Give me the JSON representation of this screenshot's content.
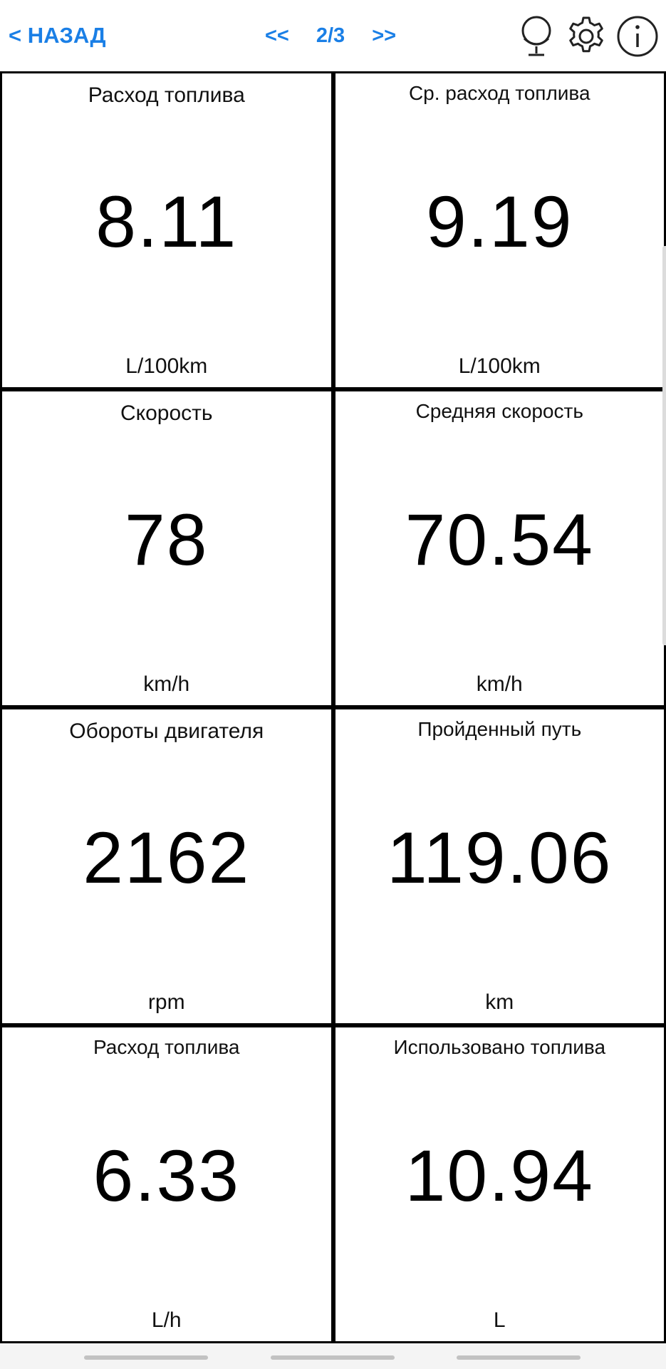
{
  "header": {
    "back_label": "< НАЗАД",
    "prev_label": "<<",
    "page_indicator": "2/3",
    "next_label": ">>",
    "icons": [
      "globe-icon",
      "gear-icon",
      "info-icon"
    ],
    "accent_color": "#1a7fe6"
  },
  "tiles": [
    {
      "title": "Расход топлива",
      "value": "8.11",
      "unit": "L/100km"
    },
    {
      "title": "Ср. расход топлива",
      "value": "9.19",
      "unit": "L/100km"
    },
    {
      "title": "Скорость",
      "value": "78",
      "unit": "km/h"
    },
    {
      "title": "Средняя скорость",
      "value": "70.54",
      "unit": "km/h"
    },
    {
      "title": "Обороты двигателя",
      "value": "2162",
      "unit": "rpm"
    },
    {
      "title": "Пройденный путь",
      "value": "119.06",
      "unit": "km"
    },
    {
      "title": "Расход топлива",
      "value": "6.33",
      "unit": "L/h"
    },
    {
      "title": "Использовано топлива",
      "value": "10.94",
      "unit": "L"
    }
  ]
}
